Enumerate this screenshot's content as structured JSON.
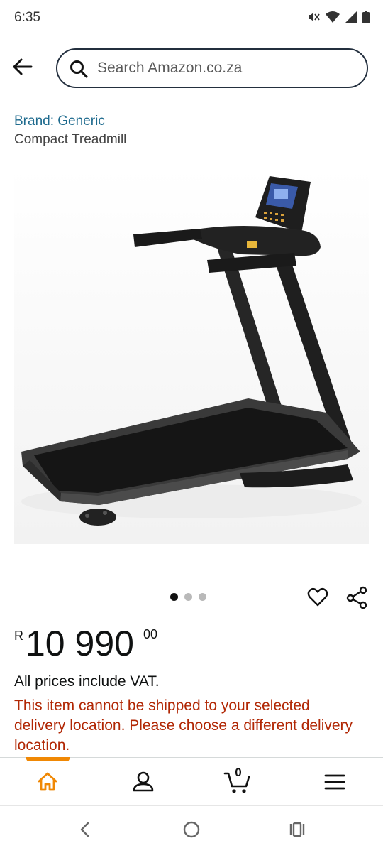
{
  "status_bar": {
    "time": "6:35",
    "icons": [
      "mute-icon",
      "wifi-icon",
      "signal-icon",
      "battery-icon"
    ]
  },
  "search": {
    "placeholder": "Search Amazon.co.za",
    "value": ""
  },
  "product": {
    "brand": "Brand: Generic",
    "title": "Compact Treadmill",
    "image_count": 3,
    "active_image_index": 0
  },
  "price": {
    "symbol": "R",
    "whole": "10 990",
    "fraction": "00"
  },
  "vat_note": "All prices include VAT.",
  "shipping_warning": "This item cannot be shipped to your selected delivery location. Please choose a different delivery location.",
  "bottom_nav": {
    "items": [
      "home-icon",
      "account-icon",
      "cart-icon",
      "menu-icon"
    ],
    "active": "home-icon",
    "cart_count": "0"
  },
  "colors": {
    "accent": "#f08804",
    "link": "#1f6b8e",
    "warning": "#b12704",
    "search_border": "#232f3e"
  }
}
